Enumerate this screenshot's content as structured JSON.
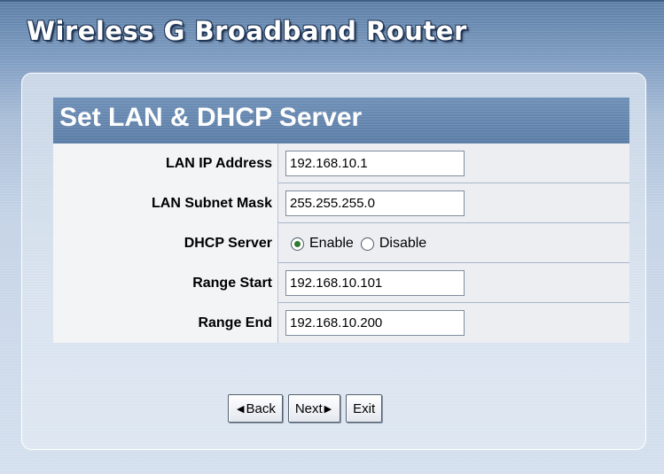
{
  "app": {
    "title": "Wireless G Broadband Router"
  },
  "section": {
    "title": "Set LAN & DHCP Server"
  },
  "fields": [
    {
      "label": "LAN IP Address",
      "value": "192.168.10.1"
    },
    {
      "label": "LAN Subnet Mask",
      "value": "255.255.255.0"
    },
    {
      "label": "DHCP Server",
      "options": [
        "Enable",
        "Disable"
      ],
      "selected": "Enable"
    },
    {
      "label": "Range Start",
      "value": "192.168.10.101"
    },
    {
      "label": "Range End",
      "value": "192.168.10.200"
    }
  ],
  "buttons": {
    "back": "Back",
    "next": "Next",
    "exit": "Exit"
  }
}
